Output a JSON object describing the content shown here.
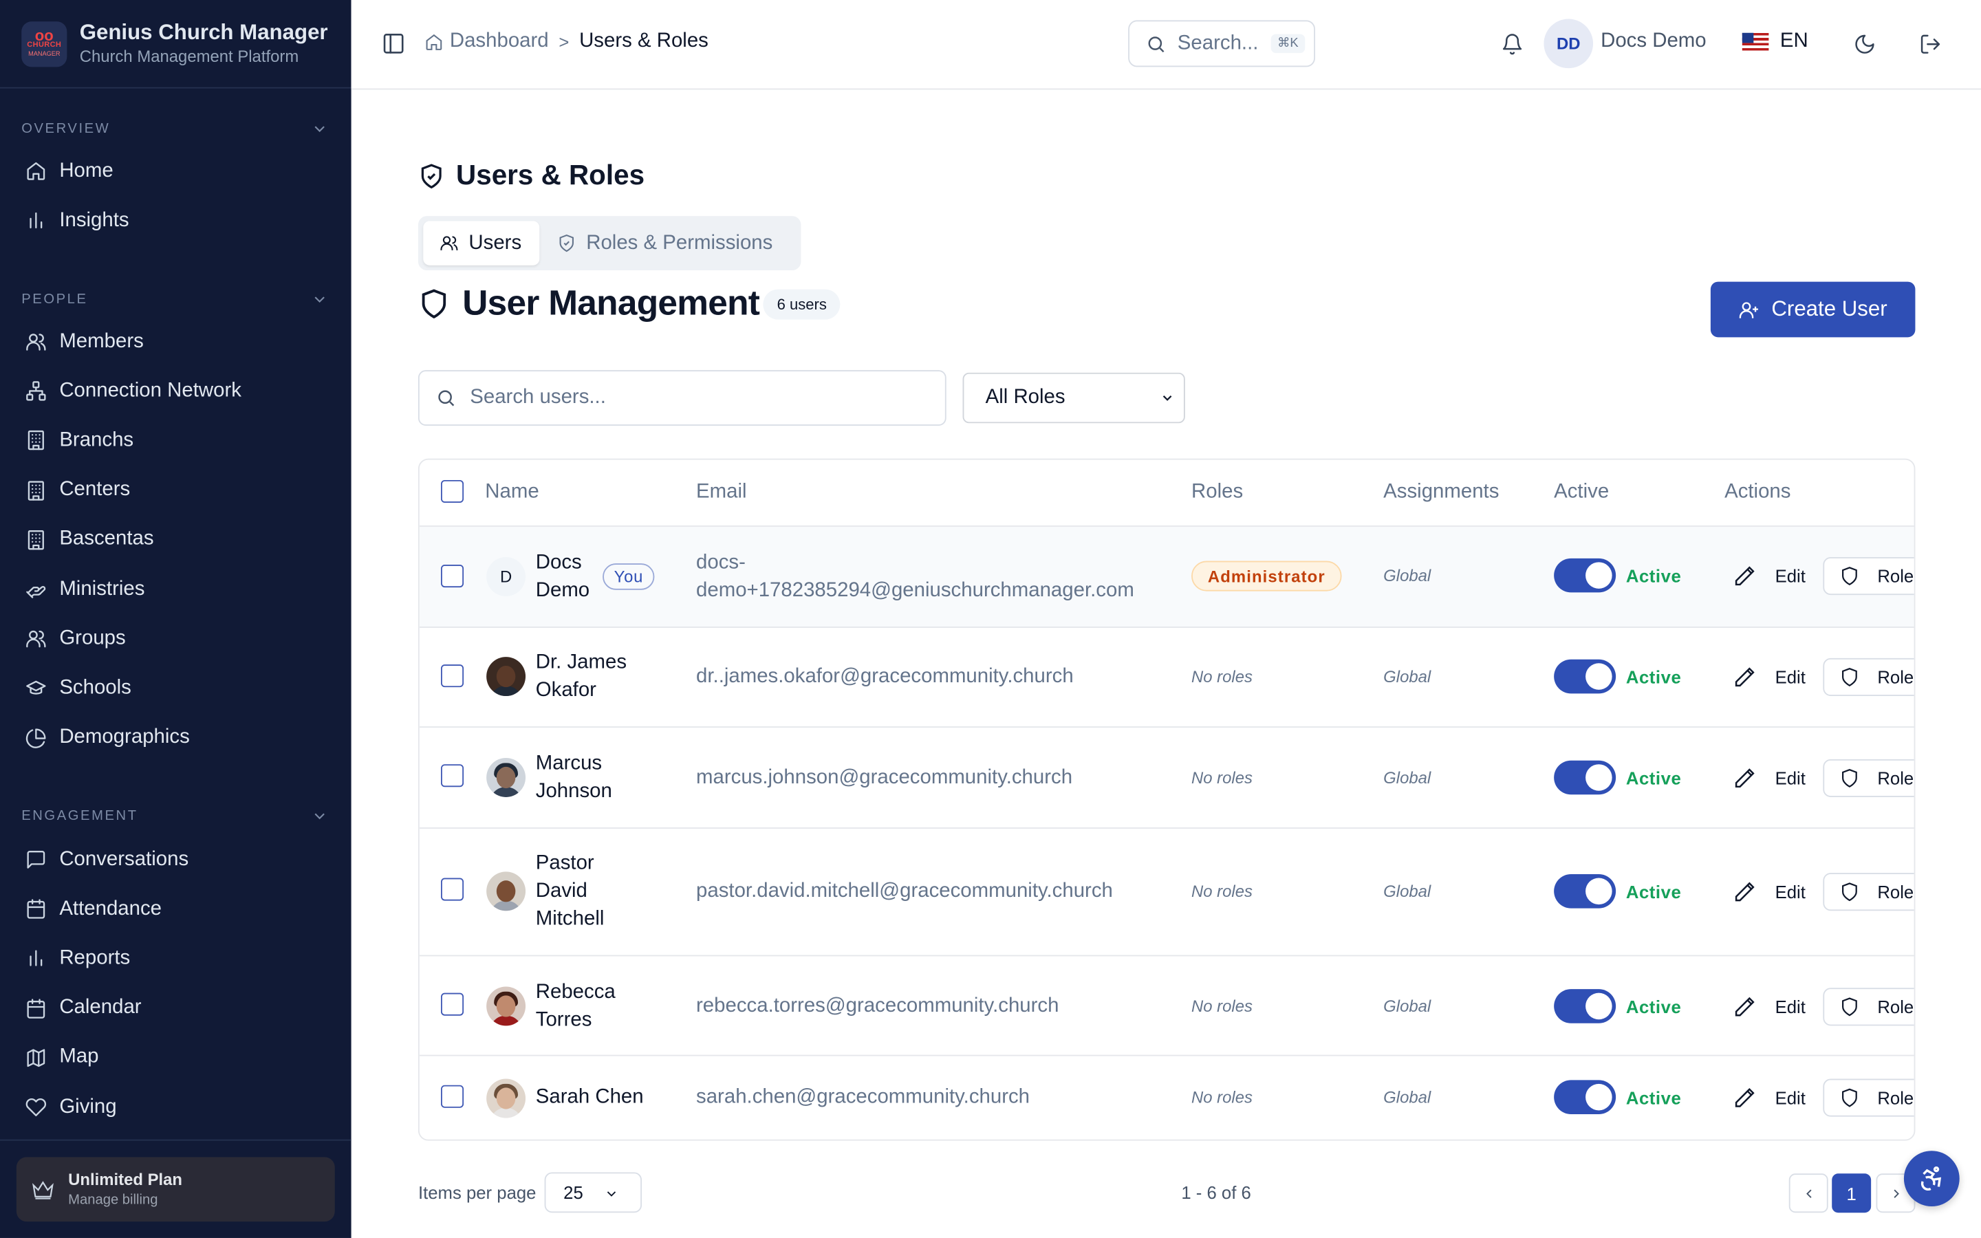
{
  "app": {
    "name": "Genius Church Manager",
    "subtitle": "Church Management Platform",
    "logo_line1": "CHURCH",
    "logo_line2": "MANAGER"
  },
  "sidebar": {
    "sections": [
      {
        "title": "OVERVIEW",
        "items": [
          "Home",
          "Insights"
        ]
      },
      {
        "title": "PEOPLE",
        "items": [
          "Members",
          "Connection Network",
          "Branchs",
          "Centers",
          "Bascentas",
          "Ministries",
          "Groups",
          "Schools",
          "Demographics"
        ]
      },
      {
        "title": "ENGAGEMENT",
        "items": [
          "Conversations",
          "Attendance",
          "Reports",
          "Calendar",
          "Map",
          "Giving"
        ]
      }
    ],
    "plan": {
      "title": "Unlimited Plan",
      "subtitle": "Manage billing"
    }
  },
  "topbar": {
    "breadcrumb_home": "Dashboard",
    "breadcrumb_current": "Users & Roles",
    "search_placeholder": "Search...",
    "search_shortcut": "⌘K",
    "avatar_initials": "DD",
    "user_name": "Docs Demo",
    "language": "EN"
  },
  "page": {
    "title": "Users & Roles",
    "tabs": [
      "Users",
      "Roles & Permissions"
    ],
    "section_title": "User Management",
    "user_count": "6 users",
    "create_button": "Create User",
    "search_placeholder": "Search users...",
    "role_filter": "All Roles"
  },
  "table": {
    "headers": [
      "Name",
      "Email",
      "Roles",
      "Assignments",
      "Active",
      "Actions"
    ],
    "rows": [
      {
        "name": "Docs Demo",
        "you": "You",
        "initial": "D",
        "email": "docs-demo+1782385294@geniuschurchmanager.com",
        "role": "Administrator",
        "assignment": "Global",
        "status": "Active",
        "edit": "Edit",
        "roles": "Roles"
      },
      {
        "name": "Dr. James Okafor",
        "email": "dr..james.okafor@gracecommunity.church",
        "role": "No roles",
        "assignment": "Global",
        "status": "Active",
        "edit": "Edit",
        "roles": "Roles"
      },
      {
        "name": "Marcus Johnson",
        "email": "marcus.johnson@gracecommunity.church",
        "role": "No roles",
        "assignment": "Global",
        "status": "Active",
        "edit": "Edit",
        "roles": "Roles"
      },
      {
        "name": "Pastor David Mitchell",
        "email": "pastor.david.mitchell@gracecommunity.church",
        "role": "No roles",
        "assignment": "Global",
        "status": "Active",
        "edit": "Edit",
        "roles": "Roles"
      },
      {
        "name": "Rebecca Torres",
        "email": "rebecca.torres@gracecommunity.church",
        "role": "No roles",
        "assignment": "Global",
        "status": "Active",
        "edit": "Edit",
        "roles": "Roles"
      },
      {
        "name": "Sarah Chen",
        "email": "sarah.chen@gracecommunity.church",
        "role": "No roles",
        "assignment": "Global",
        "status": "Active",
        "edit": "Edit",
        "roles": "Roles"
      }
    ]
  },
  "footer": {
    "items_per_page_label": "Items per page",
    "items_per_page": "25",
    "range": "1 - 6 of 6",
    "page": "1"
  },
  "colors": {
    "accent": "#2f4fb5",
    "sidebar": "#111a36",
    "active_green": "#15a05a"
  }
}
